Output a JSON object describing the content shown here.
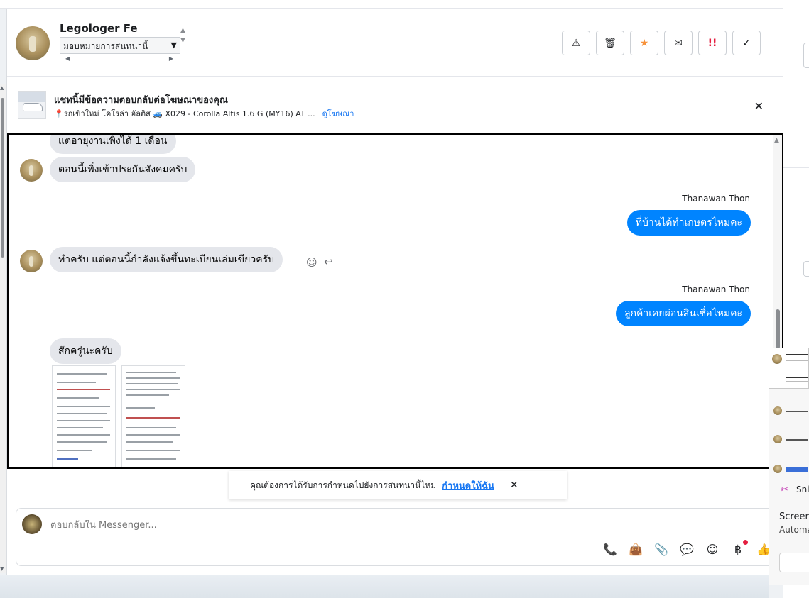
{
  "header": {
    "contact_name": "Legologer Fe",
    "assign_label": "มอบหมายการสนทนานี้",
    "actions": [
      {
        "name": "report-button",
        "icon": "⚠"
      },
      {
        "name": "delete-button",
        "icon": "🗑"
      },
      {
        "name": "star-button",
        "icon": "★"
      },
      {
        "name": "mark-unread-button",
        "icon": "✉"
      },
      {
        "name": "spam-button",
        "icon": "!!"
      },
      {
        "name": "done-button",
        "icon": "✓"
      }
    ]
  },
  "ad_banner": {
    "title": "แชทนี้มีข้อความตอบกลับต่อโฆษณาของคุณ",
    "subtitle": "รถเข้าใหม่ โคโรล่า อัลติส 🚙 X029 - Corolla Altis 1.6 G (MY16) AT ...",
    "pin": "📍",
    "link": "ดูโฆษณา",
    "close": "✕"
  },
  "messages": {
    "m0": "แต่อายุงานเพิ่งได้ 1 เดือน",
    "m1": "ตอนนี้เพิ่งเข้าประกันสังคมครับ",
    "sender1": "Thanawan Thon",
    "m2": "ที่บ้านได้ทำเกษตรไหมคะ",
    "m3": "ทำครับ แต่ตอนนี้กำลังแจ้งขึ้นทะเบียนเล่มเขียวครับ",
    "sender2": "Thanawan Thon",
    "m4": "ลูกค้าเคยผ่อนสินเชื่อไหมคะ",
    "m5": "สักครู่นะครับ"
  },
  "toast": {
    "text": "คุณต้องการได้รับการกำหนดไปยังการสนทนานี้ไหม",
    "link": "กำหนดให้ฉัน",
    "close": "✕"
  },
  "composer": {
    "placeholder": "ตอบกลับใน Messenger...",
    "tools": [
      "📞",
      "👜",
      "📎",
      "💬",
      "☺",
      "฿",
      "👍"
    ]
  },
  "snip": {
    "title": "Snipping Tool",
    "heading": "Screenshot copied to clipboard",
    "sub": "Automatically saved to screenshots folder"
  }
}
